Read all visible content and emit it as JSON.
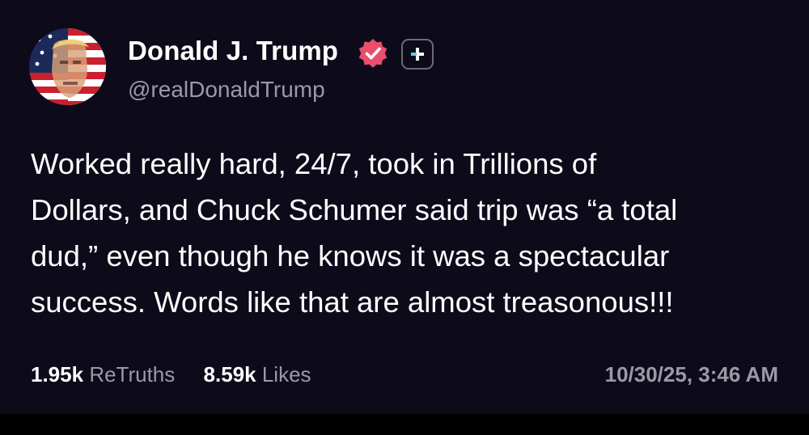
{
  "author": {
    "display_name": "Donald J. Trump",
    "handle": "@realDonaldTrump",
    "verified_icon": "verified-badge-icon",
    "follow_icon": "plus-icon"
  },
  "post": {
    "lines": [
      "Worked really hard, 24/7, took in Trillions of",
      "Dollars, and Chuck Schumer said trip was “a total",
      "dud,” even though he knows it was a spectacular",
      "success. Words like that are almost treasonous!!!"
    ]
  },
  "stats": {
    "retruths_count": "1.95k",
    "retruths_label": "ReTruths",
    "likes_count": "8.59k",
    "likes_label": "Likes"
  },
  "timestamp": "10/30/25, 3:46 AM",
  "colors": {
    "background": "#0d0b1a",
    "verified_badge": "#e94f6d",
    "follow_plus_cyan": "#5ad1e6",
    "muted_text": "#9a9aa6"
  }
}
